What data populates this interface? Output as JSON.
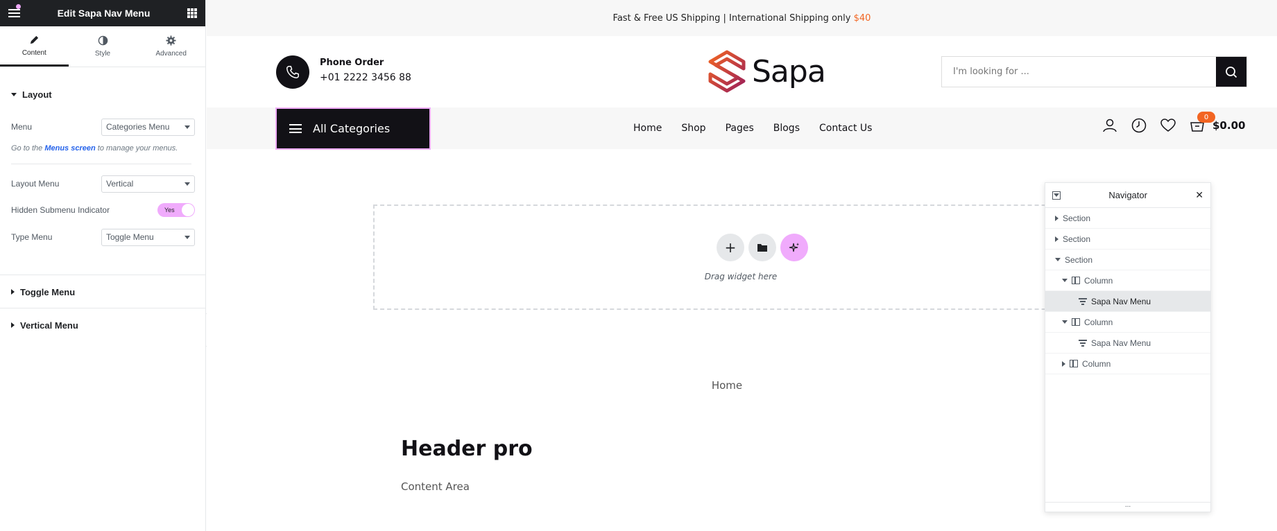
{
  "panel": {
    "title": "Edit Sapa Nav Menu",
    "tabs": [
      {
        "label": "Content",
        "icon": "pencil-icon"
      },
      {
        "label": "Style",
        "icon": "half-circle-icon"
      },
      {
        "label": "Advanced",
        "icon": "gear-icon"
      }
    ],
    "layout": {
      "title": "Layout",
      "menu_label": "Menu",
      "menu_value": "Categories Menu",
      "note_prefix": "Go to the",
      "note_link": "Menus screen",
      "note_suffix": "to manage your menus.",
      "layout_menu_label": "Layout Menu",
      "layout_menu_value": "Vertical",
      "hidden_indicator_label": "Hidden Submenu Indicator",
      "hidden_indicator_value": "Yes",
      "type_menu_label": "Type Menu",
      "type_menu_value": "Toggle Menu"
    },
    "sections": [
      "Toggle Menu",
      "Vertical Menu"
    ]
  },
  "site": {
    "topbar_text": "Fast & Free US Shipping | International Shipping only",
    "topbar_price": "$40",
    "phone_title": "Phone Order",
    "phone_number": "+01 2222 3456 88",
    "logo_text": "Sapa",
    "search_placeholder": "I'm looking for ...",
    "all_categories": "All Categories",
    "menu": [
      "Home",
      "Shop",
      "Pages",
      "Blogs",
      "Contact Us"
    ],
    "cart_count": "0",
    "cart_total": "$0.00",
    "dropzone_label": "Drag widget here",
    "breadcrumb": "Home",
    "page_title": "Header pro",
    "content_area": "Content Area"
  },
  "navigator": {
    "title": "Navigator",
    "items": [
      {
        "label": "Section",
        "type": "section",
        "expanded": false,
        "level": 0
      },
      {
        "label": "Section",
        "type": "section",
        "expanded": false,
        "level": 0
      },
      {
        "label": "Section",
        "type": "section",
        "expanded": true,
        "level": 0
      },
      {
        "label": "Column",
        "type": "column",
        "expanded": true,
        "level": 1
      },
      {
        "label": "Sapa Nav Menu",
        "type": "widget",
        "level": 2,
        "selected": true
      },
      {
        "label": "Column",
        "type": "column",
        "expanded": true,
        "level": 1
      },
      {
        "label": "Sapa Nav Menu",
        "type": "widget",
        "level": 2
      },
      {
        "label": "Column",
        "type": "column",
        "expanded": false,
        "level": 1
      }
    ],
    "footer": "..."
  },
  "colors": {
    "accent": "#f26522",
    "dark": "#121116",
    "highlight": "#f0abfc"
  }
}
